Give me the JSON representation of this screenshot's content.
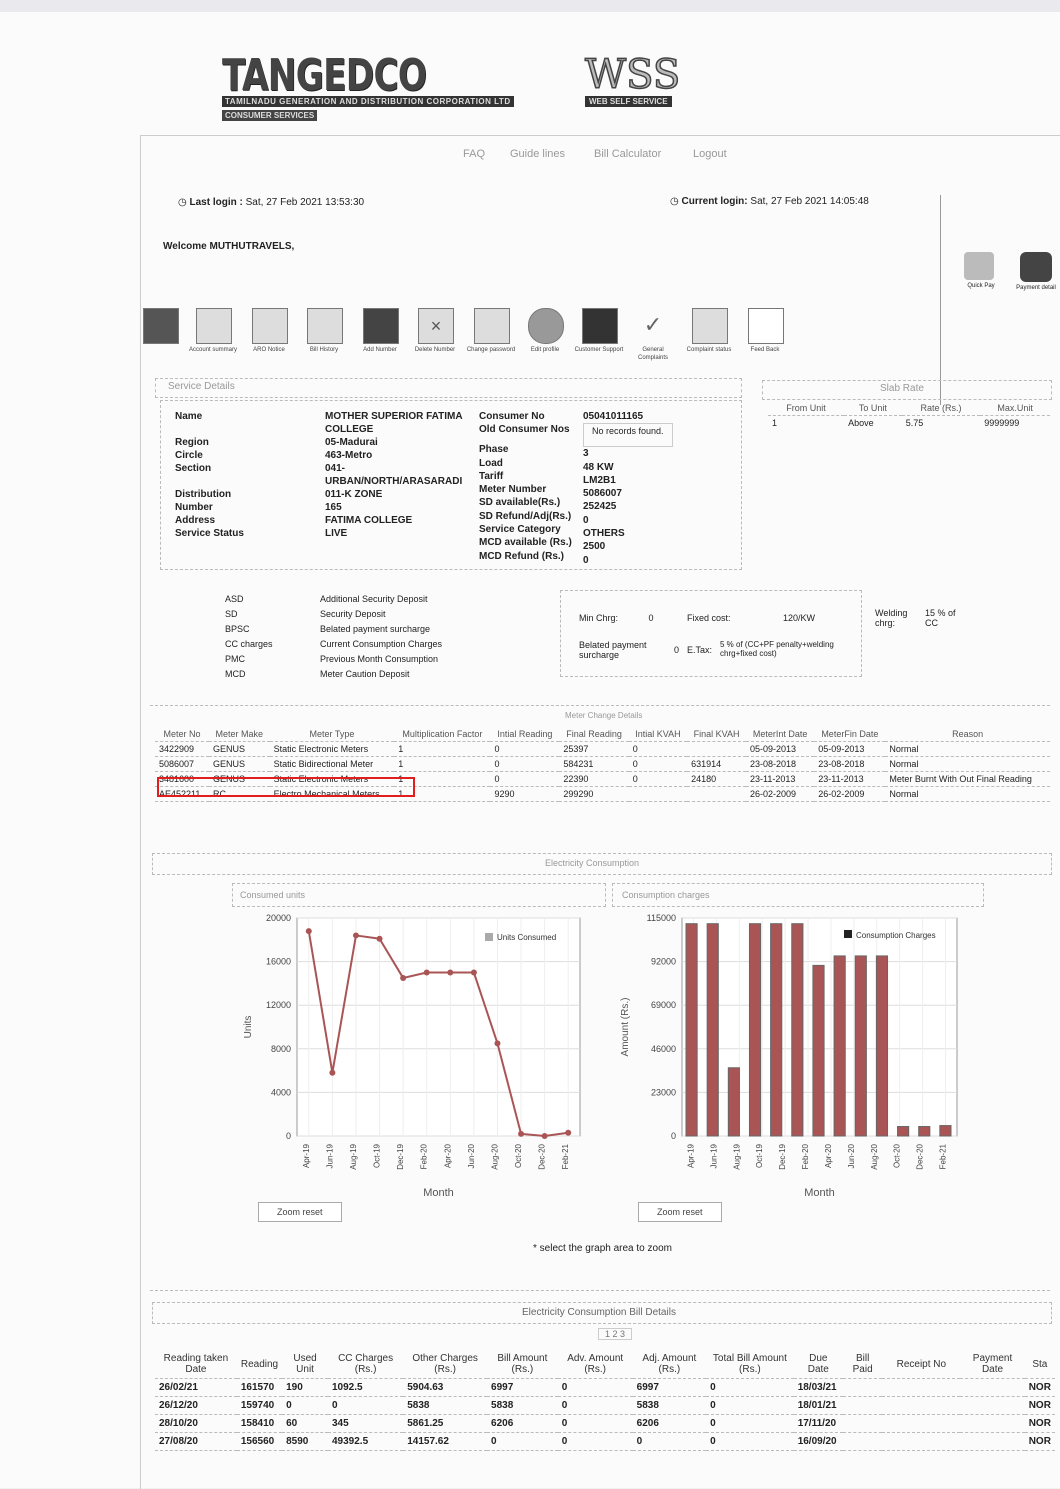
{
  "brand": {
    "logo_title": "TANGEDCO",
    "logo_sub1": "TAMILNADU GENERATION AND DISTRIBUTION CORPORATION LTD",
    "logo_sub2": "CONSUMER SERVICES",
    "wss_title": "WSS",
    "wss_sub": "WEB SELF SERVICE"
  },
  "nav": {
    "faq": "FAQ",
    "guidelines": "Guide lines",
    "bill_calc": "Bill Calculator",
    "logout": "Logout"
  },
  "login": {
    "last_label": "Last login :",
    "last_value": "Sat, 27 Feb 2021 13:53:30",
    "current_label": "Current login:",
    "current_value": "Sat, 27 Feb 2021 14:05:48",
    "welcome": "Welcome MUTHUTRAVELS,"
  },
  "side_icons": {
    "quick_pay": "Quick Pay",
    "payment": "Payment detail"
  },
  "toolbar": [
    "Account summary",
    "ARO Notice",
    "Bill History",
    "Add Number",
    "Delete Number",
    "Change password",
    "Edit profile",
    "Customer Support",
    "General Complaints",
    "Complaint status",
    "Feed Back"
  ],
  "service": {
    "title": "Service Details",
    "left_labels": [
      "Name",
      "Region",
      "Circle",
      "Section",
      "Distribution",
      "Number",
      "Address",
      "Service Status"
    ],
    "left_values": [
      "MOTHER SUPERIOR FATIMA COLLEGE",
      "05-Madurai",
      "463-Metro",
      "041-URBAN/NORTH/ARASARADI",
      "011-K ZONE",
      "165",
      "FATIMA COLLEGE",
      "LIVE"
    ],
    "right_labels": [
      "Consumer No",
      "Old Consumer Nos",
      "Phase",
      "Load",
      "Tariff",
      "Meter Number",
      "SD available(Rs.)",
      "SD Refund/Adj(Rs.)",
      "Service Category",
      "MCD available (Rs.)",
      "MCD Refund (Rs.)"
    ],
    "right_values": [
      "05041011165",
      "No records found.",
      "3",
      "48 KW",
      "LM2B1",
      "5086007",
      "252425",
      "0",
      "OTHERS",
      "2500",
      "0"
    ]
  },
  "slab": {
    "title": "Slab Rate",
    "headers": [
      "From Unit",
      "To Unit",
      "Rate (Rs.)",
      "Max.Unit"
    ],
    "row": [
      "1",
      "Above",
      "5.75",
      "9999999"
    ]
  },
  "abbrev": [
    [
      "ASD",
      "Additional Security Deposit"
    ],
    [
      "SD",
      "Security Deposit"
    ],
    [
      "BPSC",
      "Belated payment surcharge"
    ],
    [
      "CC charges",
      "Current Consumption Charges"
    ],
    [
      "PMC",
      "Previous Month Consumption"
    ],
    [
      "MCD",
      "Meter Caution Deposit"
    ]
  ],
  "charges": {
    "min_chrg_label": "Min Chrg:",
    "min_chrg": "0",
    "fixed_label": "Fixed cost:",
    "fixed": "120/KW",
    "welding_label": "Welding chrg:",
    "welding": "15 % of CC",
    "belated_label": "Belated payment surcharge",
    "belated": "0",
    "etax_label": "E.Tax:",
    "etax": "5 % of (CC+PF penalty+welding chrg+fixed cost)"
  },
  "meter": {
    "title": "Meter Change Details",
    "headers": [
      "Meter No",
      "Meter Make",
      "Meter Type",
      "Multiplication Factor",
      "Intial Reading",
      "Final Reading",
      "Intial KVAH",
      "Final KVAH",
      "MeterInt Date",
      "MeterFin Date",
      "Reason"
    ],
    "rows": [
      [
        "3422909",
        "GENUS",
        "Static Electronic Meters",
        "1",
        "0",
        "25397",
        "0",
        "",
        "05-09-2013",
        "05-09-2013",
        "Normal"
      ],
      [
        "5086007",
        "GENUS",
        "Static Bidirectional Meter",
        "1",
        "0",
        "584231",
        "0",
        "631914",
        "23-08-2018",
        "23-08-2018",
        "Normal"
      ],
      [
        "3481600",
        "GENUS",
        "Static Electronic Meters",
        "1",
        "0",
        "22390",
        "0",
        "24180",
        "23-11-2013",
        "23-11-2013",
        "Meter Burnt With Out Final Reading"
      ],
      [
        "AE452211",
        "RC",
        "Electro Mechanical Meters",
        "1",
        "9290",
        "299290",
        "",
        "",
        "26-02-2009",
        "26-02-2009",
        "Normal"
      ]
    ]
  },
  "consumption_title": "Electricity Consumption",
  "chart_data": [
    {
      "type": "line",
      "title": "Consumed units",
      "series": [
        {
          "name": "Units Consumed",
          "values": [
            18800,
            5800,
            18400,
            18100,
            14500,
            15000,
            15000,
            15000,
            8500,
            200,
            0,
            300
          ]
        }
      ],
      "categories": [
        "Apr-19",
        "Jun-19",
        "Aug-19",
        "Oct-19",
        "Dec-19",
        "Feb-20",
        "Apr-20",
        "Jun-20",
        "Aug-20",
        "Oct-20",
        "Dec-20",
        "Feb-21"
      ],
      "xlabel": "Month",
      "ylabel": "Units",
      "ylim": [
        0,
        20000
      ],
      "yticks": [
        "0",
        "4000",
        "8000",
        "12000",
        "16000",
        "20000"
      ],
      "zoom": "Zoom reset"
    },
    {
      "type": "bar",
      "title": "Consumption charges",
      "series": [
        {
          "name": "Consumption Charges",
          "values": [
            112000,
            112000,
            36000,
            112000,
            112000,
            112000,
            90000,
            95000,
            95000,
            95000,
            5000,
            5000,
            5500
          ]
        }
      ],
      "categories": [
        "Apr-19",
        "Jun-19",
        "Aug-19",
        "Oct-19",
        "Dec-19",
        "Feb-20",
        "Apr-20",
        "Jun-20",
        "Aug-20",
        "Oct-20",
        "Dec-20",
        "Feb-21"
      ],
      "xlabel": "Month",
      "ylabel": "Amount (Rs.)",
      "ylim": [
        0,
        115000
      ],
      "yticks": [
        "0",
        "23000",
        "46000",
        "69000",
        "92000",
        "115000"
      ],
      "zoom": "Zoom reset"
    }
  ],
  "zoom_note": "* select the graph area to zoom",
  "bill": {
    "title": "Electricity Consumption Bill Details",
    "pager": "1 2 3",
    "headers": [
      "Reading taken Date",
      "Reading",
      "Used Unit",
      "CC Charges (Rs.)",
      "Other Charges (Rs.)",
      "Bill Amount (Rs.)",
      "Adv. Amount (Rs.)",
      "Adj. Amount (Rs.)",
      "Total Bill Amount (Rs.)",
      "Due Date",
      "Bill Paid",
      "Receipt No",
      "Payment Date",
      "Sta"
    ],
    "rows": [
      [
        "26/02/21",
        "161570",
        "190",
        "1092.5",
        "5904.63",
        "6997",
        "0",
        "6997",
        "0",
        "18/03/21",
        "",
        "",
        "",
        "NOR"
      ],
      [
        "26/12/20",
        "159740",
        "0",
        "0",
        "5838",
        "5838",
        "0",
        "5838",
        "0",
        "18/01/21",
        "",
        "",
        "",
        "NOR"
      ],
      [
        "28/10/20",
        "158410",
        "60",
        "345",
        "5861.25",
        "6206",
        "0",
        "6206",
        "0",
        "17/11/20",
        "",
        "",
        "",
        "NOR"
      ],
      [
        "27/08/20",
        "156560",
        "8590",
        "49392.5",
        "14157.62",
        "0",
        "0",
        "0",
        "0",
        "16/09/20",
        "",
        "",
        "",
        "NOR"
      ]
    ]
  },
  "highlight_color": "#e11d1d"
}
